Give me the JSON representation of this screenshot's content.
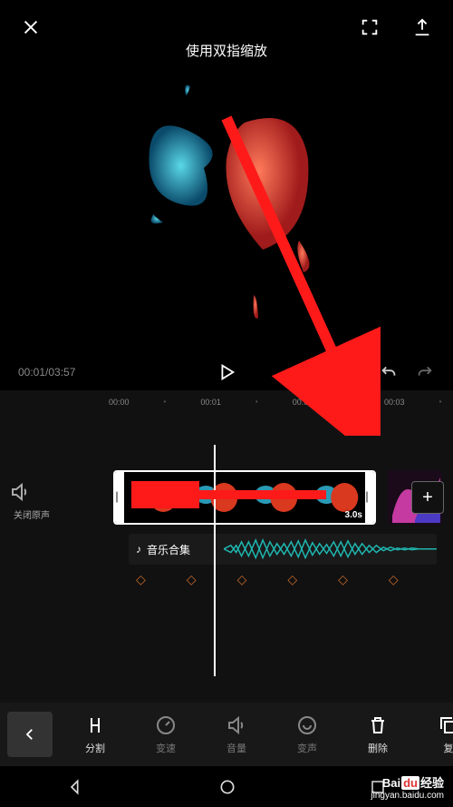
{
  "header": {
    "hint": "使用双指缩放"
  },
  "playback": {
    "current_time": "00:01",
    "total_time": "03:57"
  },
  "ruler": {
    "ticks": [
      "00:00",
      "00:01",
      "00:02",
      "00:03"
    ]
  },
  "mute": {
    "label": "关闭原声"
  },
  "clip": {
    "duration": "3.0s"
  },
  "music": {
    "label": "音乐合集",
    "icon": "♪"
  },
  "add": {
    "symbol": "+"
  },
  "toolbar": {
    "items": [
      {
        "name": "split",
        "label": "分割",
        "active": true
      },
      {
        "name": "speed",
        "label": "变速",
        "active": false
      },
      {
        "name": "volume",
        "label": "音量",
        "active": false
      },
      {
        "name": "voice-change",
        "label": "变声",
        "active": false
      },
      {
        "name": "delete",
        "label": "删除",
        "active": true
      },
      {
        "name": "copy",
        "label": "复",
        "active": true
      }
    ]
  },
  "watermark": {
    "brand_prefix": "Bai",
    "brand_mid": "du",
    "brand_suffix": "经验",
    "url": "jingyan.baidu.com"
  },
  "colors": {
    "accent_red": "#ff1a1a",
    "accent_teal": "#1fb8b1"
  }
}
